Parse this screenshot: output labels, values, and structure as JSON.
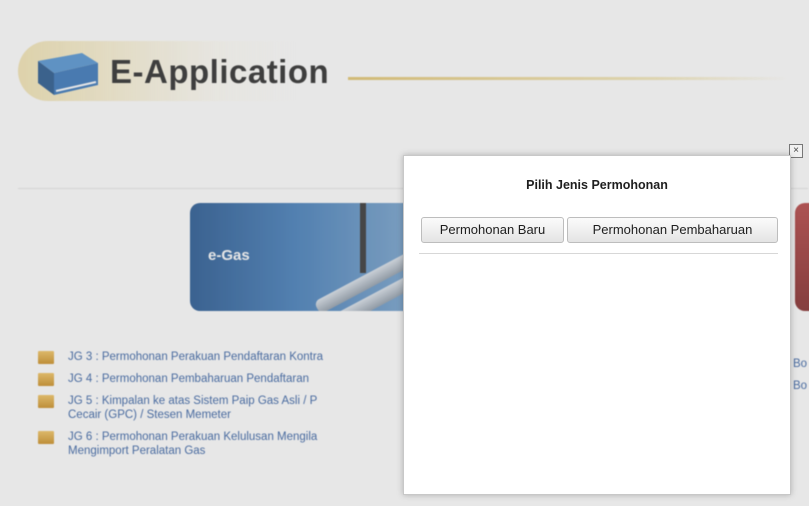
{
  "header": {
    "title": "E-Application"
  },
  "banners": {
    "egas_label": "e-Gas"
  },
  "list": [
    "JG 3 : Permohonan Perakuan Pendaftaran Kontra",
    "JG 4 : Permohonan Pembaharuan Pendaftaran",
    "JG 5 : Kimpalan ke atas Sistem Paip Gas Asli / P",
    "Cecair (GPC) / Stesen Memeter",
    "JG 6 : Permohonan Perakuan Kelulusan Mengila",
    "Mengimport Peralatan Gas"
  ],
  "right_links": [
    "Bo",
    "Bo"
  ],
  "modal": {
    "close_label": "×",
    "title": "Pilih Jenis Permohonan",
    "buttons": {
      "new": "Permohonan Baru",
      "renew": "Permohonan Pembaharuan"
    }
  },
  "icons": {
    "book": "book-icon",
    "bullet": "bullet-icon",
    "close": "close-icon"
  },
  "colors": {
    "link": "#2d5aa0",
    "bullet": "#e0a534",
    "banner": "#1b4f8c",
    "title": "#1f1f1f"
  }
}
